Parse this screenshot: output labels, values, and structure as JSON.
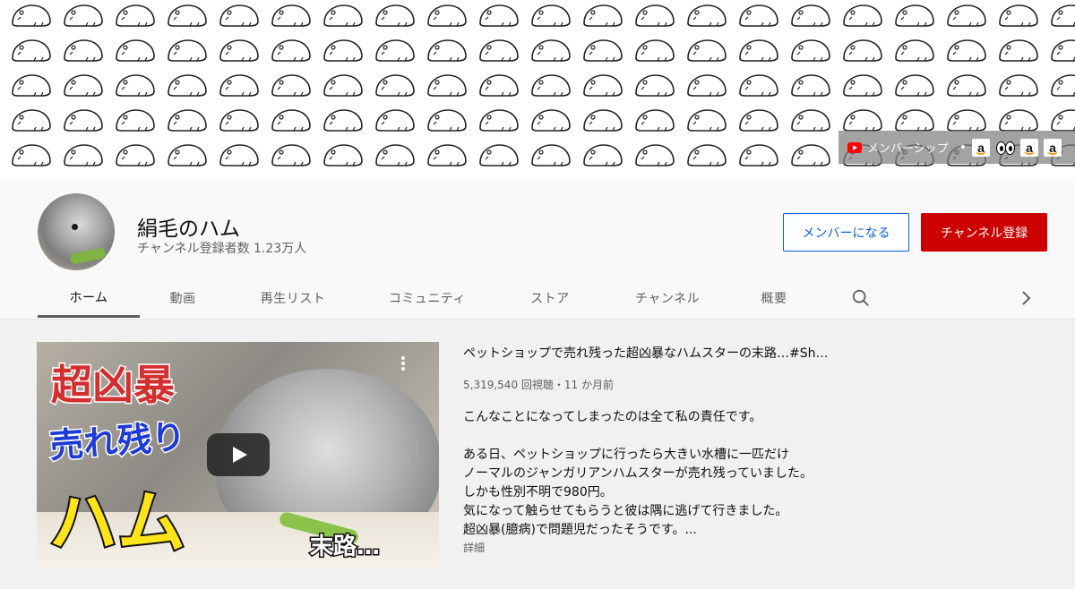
{
  "banner": {
    "membership_link": "メンバーシップ",
    "separator": "•",
    "icons": [
      "youtube-icon",
      "amazon-icon",
      "eyes-icon",
      "amazon-icon",
      "amazon-icon"
    ]
  },
  "channel": {
    "name": "絹毛のハム",
    "subscribers": "チャンネル登録者数 1.23万人",
    "join_label": "メンバーになる",
    "subscribe_label": "チャンネル登録",
    "subscribe_color": "#cc0000",
    "join_color": "#065fd4"
  },
  "tabs": [
    {
      "label": "ホーム",
      "active": true
    },
    {
      "label": "動画"
    },
    {
      "label": "再生リスト"
    },
    {
      "label": "コミュニティ"
    },
    {
      "label": "ストア"
    },
    {
      "label": "チャンネル"
    },
    {
      "label": "概要"
    }
  ],
  "featured_video": {
    "thumbnail_text": [
      "超凶暴",
      "売れ残り",
      "ハム",
      "末路…"
    ],
    "title": "ペットショップで売れ残った超凶暴なハムスターの末路…#Sh…",
    "meta": "5,319,540 回視聴・11 か月前",
    "description": [
      "こんなことになってしまったのは全て私の責任です。",
      "",
      "ある日、ペットショップに行ったら大きい水槽に一匹だけ",
      "ノーマルのジャンガリアンハムスターが売れ残っていました。",
      "しかも性別不明で980円。",
      "気になって触らせてもらうと彼は隅に逃げて行きました。",
      "超凶暴(臆病)で問題児だったそうです。..."
    ],
    "read_more": "詳細"
  }
}
